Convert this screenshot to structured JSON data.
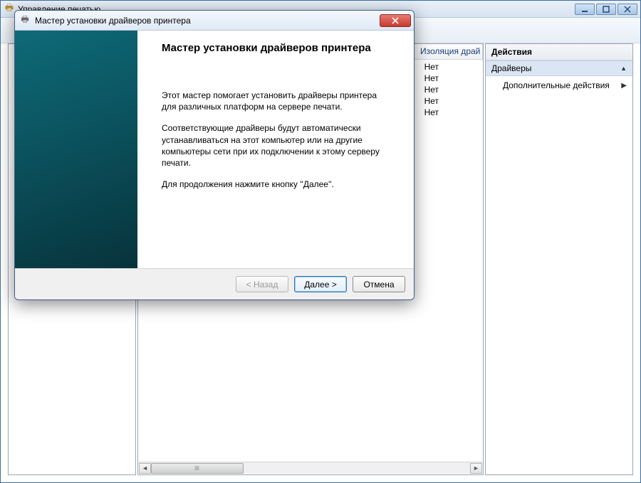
{
  "main_window": {
    "title": "Управление печатью",
    "controls": {
      "min": "_",
      "max": "◻",
      "close": "✕"
    }
  },
  "list": {
    "column_isolation": "Изоляция драй",
    "rows": [
      "Нет",
      "Нет",
      "Нет",
      "Нет",
      "Нет"
    ]
  },
  "actions": {
    "title": "Действия",
    "group": "Драйверы",
    "item_more": "Дополнительные действия"
  },
  "wizard": {
    "title": "Мастер установки драйверов принтера",
    "heading": "Мастер установки драйверов принтера",
    "p1": "Этот мастер помогает установить драйверы принтера для различных платформ на сервере печати.",
    "p2": "Соответствующие драйверы будут автоматически устанавливаться на этот компьютер или на другие компьютеры сети при их подключении к этому серверу печати.",
    "p3": "Для продолжения нажмите кнопку ''Далее''.",
    "back": "< Назад",
    "next": "Далее >",
    "cancel": "Отмена"
  }
}
